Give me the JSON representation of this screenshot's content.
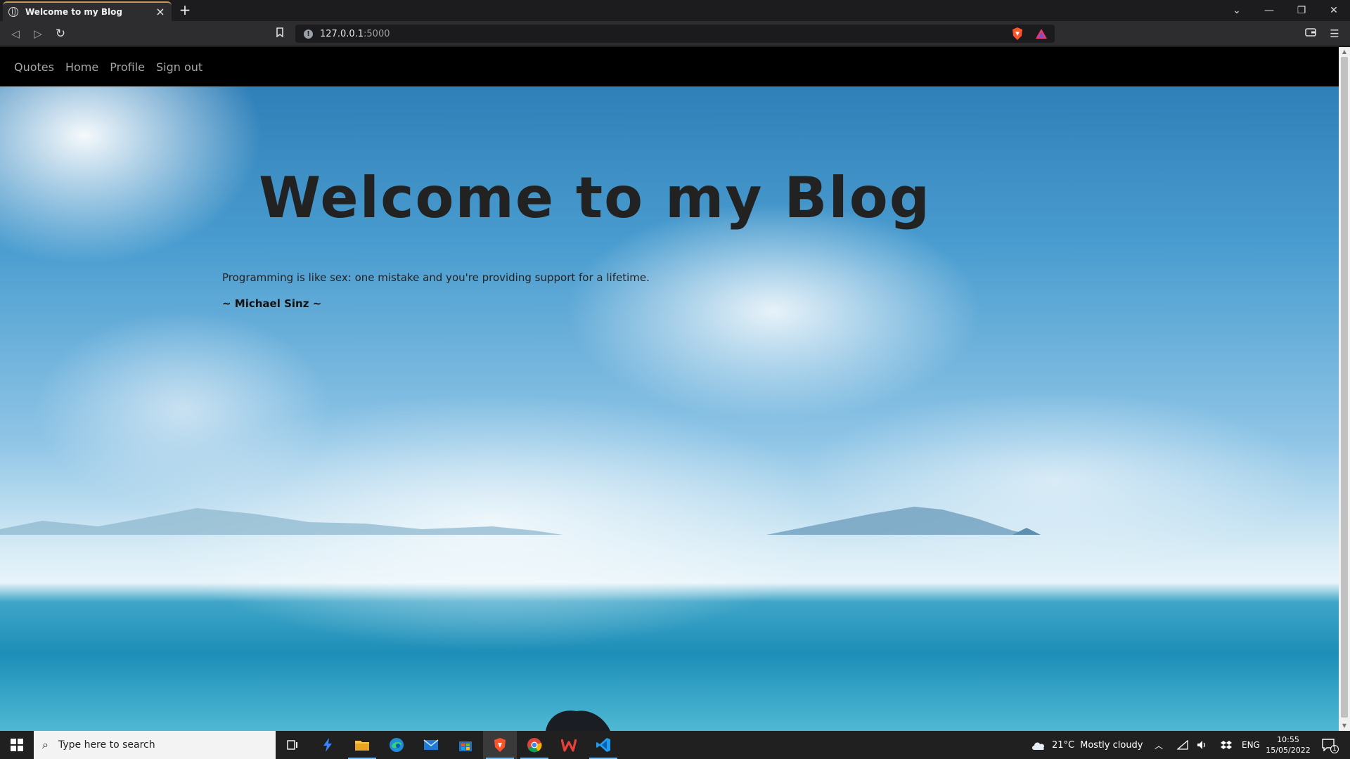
{
  "browser": {
    "tab_title": "Welcome to my Blog",
    "tab_close": "×",
    "new_tab": "+",
    "url_host": "127.0.0.1",
    "url_port": ":5000",
    "window_controls": [
      "minimize",
      "restore",
      "close"
    ]
  },
  "nav": {
    "items": [
      "Quotes",
      "Home",
      "Profile",
      "Sign out"
    ]
  },
  "page": {
    "heading": "Welcome to my Blog",
    "quote": "Programming is like sex: one mistake and you're providing support for a lifetime.",
    "author": "~ Michael Sinz ~"
  },
  "taskbar": {
    "search_placeholder": "Type here to search",
    "weather_temp": "21°C",
    "weather_desc": "Mostly cloudy",
    "language": "ENG",
    "time": "10:55",
    "date": "15/05/2022",
    "notification_count": "1"
  },
  "colors": {
    "navbar_bg": "#000000",
    "nav_text": "#a7a7a7",
    "heading_text": "#222222",
    "taskbar_bg": "#202020",
    "tab_accent": "#c89b5a"
  }
}
